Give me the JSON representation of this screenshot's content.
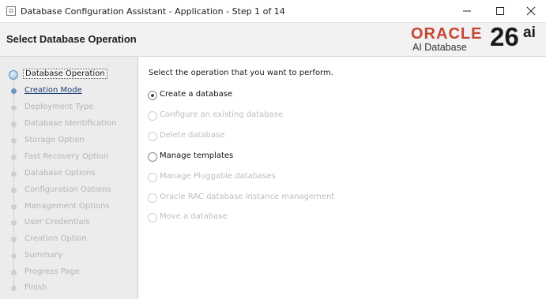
{
  "window": {
    "title": "Database Configuration Assistant - Application - Step 1 of 14",
    "icons": [
      "app-icon",
      "minimize-icon",
      "maximize-icon",
      "close-icon"
    ]
  },
  "header": {
    "page_title": "Select Database Operation",
    "logo": {
      "brand": "ORACLE",
      "product": "AI Database",
      "version": "26",
      "version_suffix": "ai",
      "brand_color": "#c74634"
    }
  },
  "sidebar": {
    "steps": [
      {
        "label": "Database Operation",
        "state": "current"
      },
      {
        "label": "Creation Mode",
        "state": "active"
      },
      {
        "label": "Deployment Type",
        "state": "disabled"
      },
      {
        "label": "Database Identification",
        "state": "disabled"
      },
      {
        "label": "Storage Option",
        "state": "disabled"
      },
      {
        "label": "Fast Recovery Option",
        "state": "disabled"
      },
      {
        "label": "Database Options",
        "state": "disabled"
      },
      {
        "label": "Configuration Options",
        "state": "disabled"
      },
      {
        "label": "Management Options",
        "state": "disabled"
      },
      {
        "label": "User Credentials",
        "state": "disabled"
      },
      {
        "label": "Creation Option",
        "state": "disabled"
      },
      {
        "label": "Summary",
        "state": "disabled"
      },
      {
        "label": "Progress Page",
        "state": "disabled"
      },
      {
        "label": "Finish",
        "state": "disabled"
      }
    ]
  },
  "content": {
    "instruction": "Select the operation that you want to perform.",
    "options": [
      {
        "label": "Create a database",
        "selected": true,
        "enabled": true
      },
      {
        "label": "Configure an existing database",
        "selected": false,
        "enabled": false
      },
      {
        "label": "Delete database",
        "selected": false,
        "enabled": false
      },
      {
        "label": "Manage templates",
        "selected": false,
        "enabled": true
      },
      {
        "label": "Manage Pluggable databases",
        "selected": false,
        "enabled": false
      },
      {
        "label": "Oracle RAC database Instance management",
        "selected": false,
        "enabled": false
      },
      {
        "label": "Move a database",
        "selected": false,
        "enabled": false
      }
    ]
  }
}
